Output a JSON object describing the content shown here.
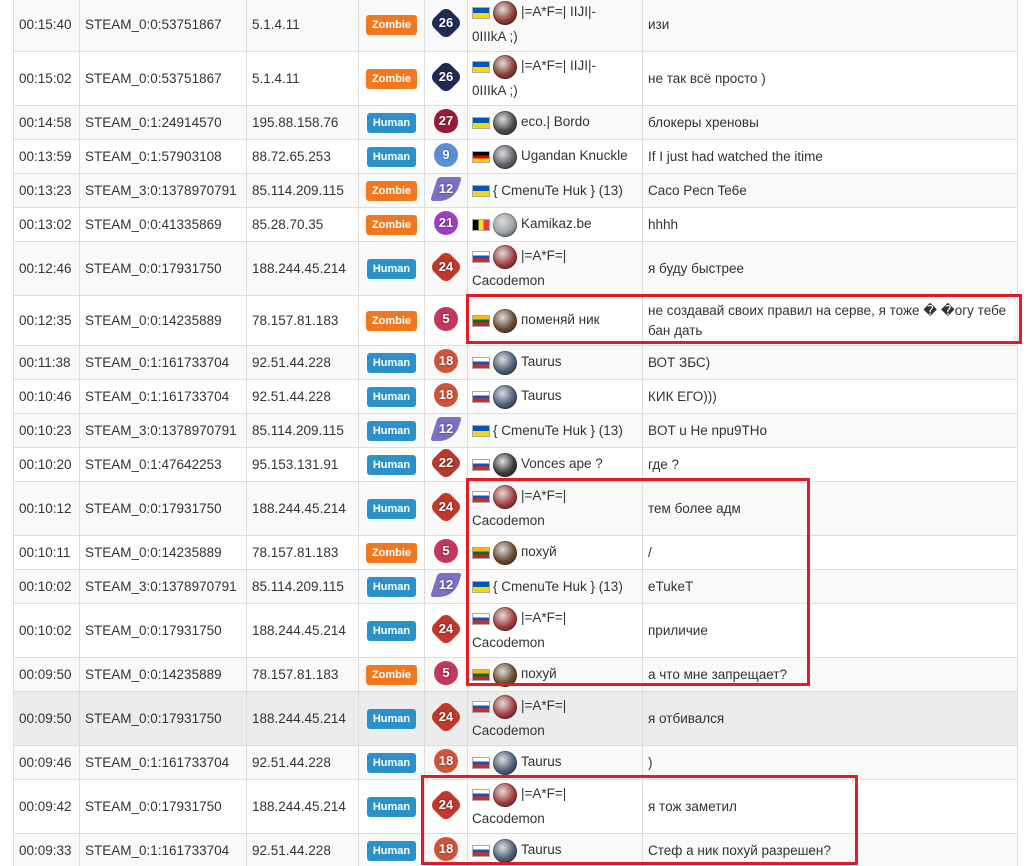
{
  "colors": {
    "zombie_badge": "#f0781e",
    "human_badge": "#2a92c8",
    "annotation_red": "#e31c23",
    "row_alt": "#f9f9f9",
    "row_highlight": "#ececec"
  },
  "rows": [
    {
      "time": "00:15:40",
      "steam": "STEAM_0:0:53751867",
      "ip": "5.1.4.11",
      "team": "Zombie",
      "level": "26",
      "level_color": "#1f2a55",
      "level_shape": "star",
      "flag": "ua",
      "avatar_color": "#8a3a30",
      "name_line1": "|=A*F=| IIJI|-",
      "name_line2": "0IIIkA ;)",
      "message": "изи",
      "height": 54
    },
    {
      "time": "00:15:02",
      "steam": "STEAM_0:0:53751867",
      "ip": "5.1.4.11",
      "team": "Zombie",
      "level": "26",
      "level_color": "#1f2a55",
      "level_shape": "star",
      "flag": "ua",
      "avatar_color": "#8a3a30",
      "name_line1": "|=A*F=| IIJI|-",
      "name_line2": "0IIIkA ;)",
      "message": "не так всё просто )",
      "height": 54
    },
    {
      "time": "00:14:58",
      "steam": "STEAM_0:1:24914570",
      "ip": "195.88.158.76",
      "team": "Human",
      "level": "27",
      "level_color": "#9c1b36",
      "level_shape": "flame",
      "flag": "ua",
      "avatar_color": "#4a4a48",
      "name_line1": "eco.| Bordo",
      "name_line2": "",
      "message": "блокеры хреновы",
      "height": 34
    },
    {
      "time": "00:13:59",
      "steam": "STEAM_0:1:57903108",
      "ip": "88.72.65.253",
      "team": "Human",
      "level": "9",
      "level_color": "#5a8fd8",
      "level_shape": "circle",
      "flag": "de",
      "avatar_color": "#5b5f66",
      "name_line1": "Ugandan Knuckle",
      "name_line2": "",
      "message": "If I just had watched the itime",
      "height": 34
    },
    {
      "time": "00:13:23",
      "steam": "STEAM_3:0:1378970791",
      "ip": "85.114.209.115",
      "team": "Zombie",
      "level": "12",
      "level_color": "#7b6fc6",
      "level_shape": "ribbon",
      "flag": "ua",
      "avatar_color": "",
      "name_line1": "{ CmenuTe Huk } (13)",
      "name_line2": "",
      "message": "Caco Pecn Te6e",
      "height": 34
    },
    {
      "time": "00:13:02",
      "steam": "STEAM_0:0:41335869",
      "ip": "85.28.70.35",
      "team": "Zombie",
      "level": "21",
      "level_color": "#9d3fbf",
      "level_shape": "circle",
      "flag": "be",
      "avatar_color": "#9aa0a6",
      "name_line1": "Kamikaz.be",
      "name_line2": "",
      "message": "hhhh",
      "height": 34
    },
    {
      "time": "00:12:46",
      "steam": "STEAM_0:0:17931750",
      "ip": "188.244.45.214",
      "team": "Human",
      "level": "24",
      "level_color": "#c0392b",
      "level_shape": "star",
      "flag": "ru",
      "avatar_color": "#a33a3a",
      "name_line1": "|=A*F=|",
      "name_line2": "Cacodemon",
      "message": "я буду быстрее",
      "height": 54
    },
    {
      "time": "00:12:35",
      "steam": "STEAM_0:0:14235889",
      "ip": "78.157.81.183",
      "team": "Zombie",
      "level": "5",
      "level_color": "#c2375c",
      "level_shape": "circle",
      "flag": "lt",
      "avatar_color": "#6b4a2e",
      "name_line1": "поменяй ник",
      "name_line2": "",
      "message": "не создавай своих правил на серве, я тоже � �огу тебе бан дать",
      "height": 50
    },
    {
      "time": "00:11:38",
      "steam": "STEAM_0:1:161733704",
      "ip": "92.51.44.228",
      "team": "Human",
      "level": "18",
      "level_color": "#d0543a",
      "level_shape": "circle",
      "flag": "ru",
      "avatar_color": "#4a5e78",
      "name_line1": "Taurus",
      "name_line2": "",
      "message": "ВОТ ЗБС)",
      "height": 34
    },
    {
      "time": "00:10:46",
      "steam": "STEAM_0:1:161733704",
      "ip": "92.51.44.228",
      "team": "Human",
      "level": "18",
      "level_color": "#d0543a",
      "level_shape": "circle",
      "flag": "ru",
      "avatar_color": "#4a5e78",
      "name_line1": "Taurus",
      "name_line2": "",
      "message": "КИК ЕГО)))",
      "height": 34
    },
    {
      "time": "00:10:23",
      "steam": "STEAM_3:0:1378970791",
      "ip": "85.114.209.115",
      "team": "Human",
      "level": "12",
      "level_color": "#7b6fc6",
      "level_shape": "ribbon",
      "flag": "ua",
      "avatar_color": "",
      "name_line1": "{ CmenuTe Huk } (13)",
      "name_line2": "",
      "message": "BOT u He npu9THo",
      "height": 34
    },
    {
      "time": "00:10:20",
      "steam": "STEAM_0:1:47642253",
      "ip": "95.153.131.91",
      "team": "Human",
      "level": "22",
      "level_color": "#b83a2e",
      "level_shape": "star",
      "flag": "ru",
      "avatar_color": "#3d3a38",
      "name_line1": "Vonces ape ?",
      "name_line2": "",
      "message": "где ?",
      "height": 34
    },
    {
      "time": "00:10:12",
      "steam": "STEAM_0:0:17931750",
      "ip": "188.244.45.214",
      "team": "Human",
      "level": "24",
      "level_color": "#c0392b",
      "level_shape": "star",
      "flag": "ru",
      "avatar_color": "#a33a3a",
      "name_line1": "|=A*F=|",
      "name_line2": "Cacodemon",
      "message": "тем более адм",
      "height": 54
    },
    {
      "time": "00:10:11",
      "steam": "STEAM_0:0:14235889",
      "ip": "78.157.81.183",
      "team": "Zombie",
      "level": "5",
      "level_color": "#c2375c",
      "level_shape": "circle",
      "flag": "lt",
      "avatar_color": "#6b4a2e",
      "name_line1": "похуй",
      "name_line2": "",
      "message": "/",
      "height": 34
    },
    {
      "time": "00:10:02",
      "steam": "STEAM_3:0:1378970791",
      "ip": "85.114.209.115",
      "team": "Human",
      "level": "12",
      "level_color": "#7b6fc6",
      "level_shape": "ribbon",
      "flag": "ua",
      "avatar_color": "",
      "name_line1": "{ CmenuTe Huk } (13)",
      "name_line2": "",
      "message": "eTukeT",
      "height": 34
    },
    {
      "time": "00:10:02",
      "steam": "STEAM_0:0:17931750",
      "ip": "188.244.45.214",
      "team": "Human",
      "level": "24",
      "level_color": "#c0392b",
      "level_shape": "star",
      "flag": "ru",
      "avatar_color": "#a33a3a",
      "name_line1": "|=A*F=|",
      "name_line2": "Cacodemon",
      "message": "приличие",
      "height": 54
    },
    {
      "time": "00:09:50",
      "steam": "STEAM_0:0:14235889",
      "ip": "78.157.81.183",
      "team": "Zombie",
      "level": "5",
      "level_color": "#c2375c",
      "level_shape": "circle",
      "flag": "lt",
      "avatar_color": "#6b4a2e",
      "name_line1": "похуй",
      "name_line2": "",
      "message": "а что мне запрещает?",
      "height": 34
    },
    {
      "time": "00:09:50",
      "steam": "STEAM_0:0:17931750",
      "ip": "188.244.45.214",
      "team": "Human",
      "level": "24",
      "level_color": "#c0392b",
      "level_shape": "star",
      "flag": "ru",
      "avatar_color": "#a33a3a",
      "name_line1": "|=A*F=|",
      "name_line2": "Cacodemon",
      "message": "я отбивался",
      "height": 54,
      "highlight": true
    },
    {
      "time": "00:09:46",
      "steam": "STEAM_0:1:161733704",
      "ip": "92.51.44.228",
      "team": "Human",
      "level": "18",
      "level_color": "#d0543a",
      "level_shape": "circle",
      "flag": "ru",
      "avatar_color": "#4a5e78",
      "name_line1": "Taurus",
      "name_line2": "",
      "message": ")",
      "height": 34
    },
    {
      "time": "00:09:42",
      "steam": "STEAM_0:0:17931750",
      "ip": "188.244.45.214",
      "team": "Human",
      "level": "24",
      "level_color": "#c0392b",
      "level_shape": "star",
      "flag": "ru",
      "avatar_color": "#a33a3a",
      "name_line1": "|=A*F=|",
      "name_line2": "Cacodemon",
      "message": "я тож заметил",
      "height": 54
    },
    {
      "time": "00:09:33",
      "steam": "STEAM_0:1:161733704",
      "ip": "92.51.44.228",
      "team": "Human",
      "level": "18",
      "level_color": "#d0543a",
      "level_shape": "circle",
      "flag": "ru",
      "avatar_color": "#4a5e78",
      "name_line1": "Taurus",
      "name_line2": "",
      "message": "Стеф а ник похуй разрешен?",
      "height": 34
    }
  ]
}
